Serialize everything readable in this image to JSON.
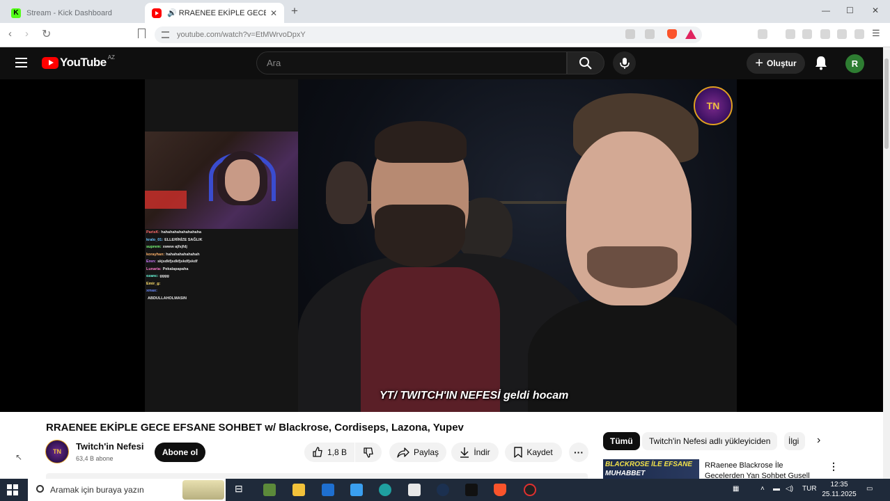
{
  "browser": {
    "tabs": [
      {
        "title": "Stream - Kick Dashboard",
        "active": false
      },
      {
        "title": "🔊 RRAENEE EKİPLE GECE EFSANE",
        "active": true
      }
    ],
    "url": "youtube.com/watch?v=EtMWrvoDpxY"
  },
  "yt_header": {
    "logo": "YouTube",
    "country": "AZ",
    "search_placeholder": "Ara",
    "create_label": "Oluştur",
    "avatar_letter": "R"
  },
  "player": {
    "watermark": "TN",
    "overlay_text": "YT/ TWITCH'IN NEFESİ",
    "overlay_text2": "geldi hocam",
    "chat": [
      {
        "name": "ParisK:",
        "msg": "hahahahahahahahaha",
        "color": "#ff6b6b"
      },
      {
        "name": "kralo_01:",
        "msg": "ELLERİNİZE SAĞLIK",
        "color": "#6bc3ff"
      },
      {
        "name": "suprem:",
        "msg": "xwww ajfsjfdj",
        "color": "#7bff7b"
      },
      {
        "name": "korayhan:",
        "msg": "hahahahahahahah",
        "color": "#ffb36b"
      },
      {
        "name": "Eren:",
        "msg": "skjsdkfjsdkfjskdfjskdf",
        "color": "#d07bff"
      },
      {
        "name": "Lunaria:",
        "msg": "Pekalapapaha",
        "color": "#ff7bd0"
      },
      {
        "name": "ozanc:",
        "msg": "gggg",
        "color": "#6bffe0"
      },
      {
        "name": "Emir_g:",
        "msg": "",
        "color": "#ffe06b"
      },
      {
        "name": "xmax:",
        "msg": "",
        "color": "#6b8bff"
      },
      {
        "name": "",
        "msg": "ABDULLAHOLMASIN",
        "color": "#ffffff"
      }
    ]
  },
  "video": {
    "title": "RRAENEE EKİPLE GECE EFSANE SOHBET w/ Blackrose, Cordiseps, Lazona, Yupev",
    "channel_name": "Twitch'in Nefesi",
    "channel_avatar_text": "TN",
    "subscribers": "63,4 B abone",
    "subscribe_label": "Abone ol",
    "likes": "1,8 B",
    "share_label": "Paylaş",
    "download_label": "İndir",
    "save_label": "Kaydet"
  },
  "sidebar": {
    "chips": [
      "Tümü",
      "Twitch'in Nefesi adlı yükleyiciden",
      "İlgi"
    ],
    "rec_thumb_text1": "BLACKROSE İLE EFSANE",
    "rec_thumb_text2": "MUHABBET",
    "rec_title_line1": "RRaenee Blackrose İle",
    "rec_title_line2": "Gecelerden Yan Sohbet Gusell"
  },
  "taskbar": {
    "search_placeholder": "Aramak için buraya yazın",
    "lang": "TUR",
    "time": "12:35",
    "date": "25.11.2025"
  }
}
